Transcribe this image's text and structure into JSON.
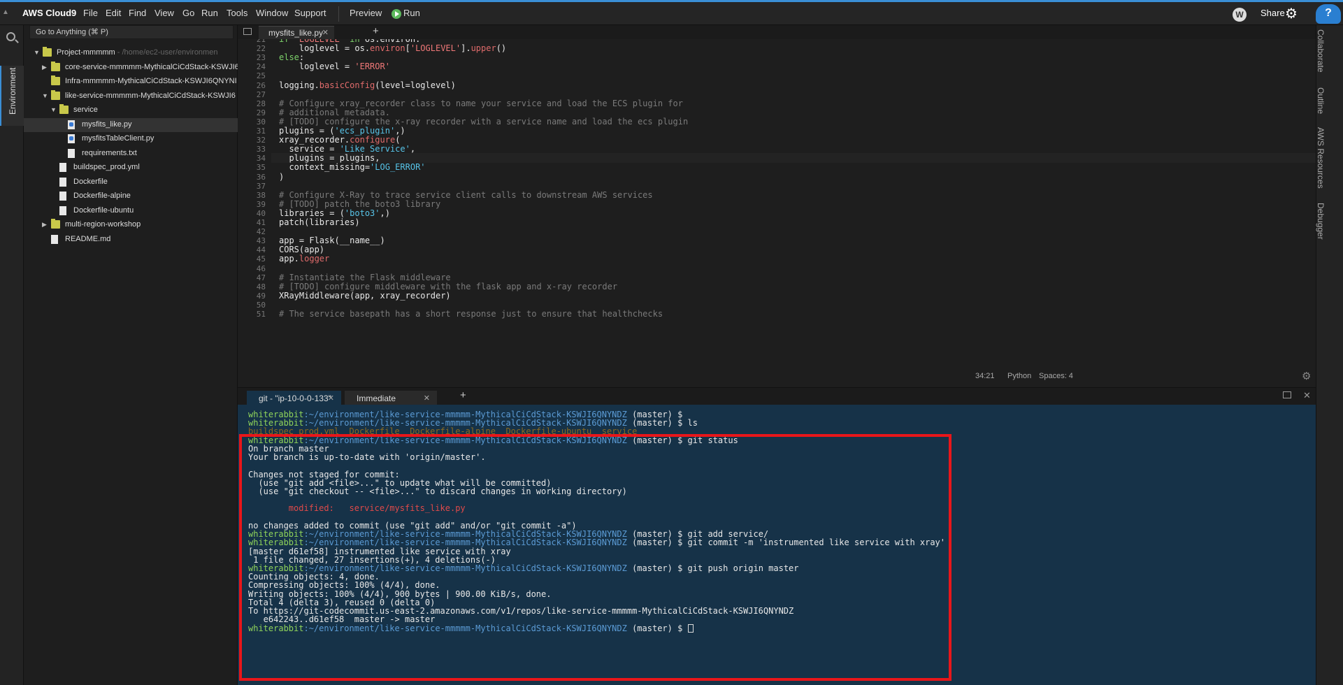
{
  "menubar": {
    "brand": "AWS Cloud9",
    "items": [
      "File",
      "Edit",
      "Find",
      "View",
      "Go",
      "Run",
      "Tools",
      "Window",
      "Support"
    ],
    "preview": "Preview",
    "run": "Run",
    "avatar": "W",
    "share": "Share"
  },
  "leftrail": {
    "environment_label": "Environment"
  },
  "search": {
    "placeholder": "Go to Anything (⌘ P)"
  },
  "tree": [
    {
      "label": "Project-mmmmm",
      "sub": " - /home/ec2-user/environmen",
      "type": "folder",
      "expanded": true
    },
    {
      "label": "core-service-mmmmm-MythicalCiCdStack-KSWJI6",
      "type": "folder",
      "expanded": false
    },
    {
      "label": "Infra-mmmmm-MythicalCiCdStack-KSWJI6QNYNI",
      "type": "folder",
      "expanded": null
    },
    {
      "label": "like-service-mmmmm-MythicalCiCdStack-KSWJI6",
      "type": "folder",
      "expanded": true
    },
    {
      "label": "service",
      "type": "folder",
      "expanded": true
    },
    {
      "label": "mysfits_like.py",
      "type": "py",
      "selected": true
    },
    {
      "label": "mysfitsTableClient.py",
      "type": "py"
    },
    {
      "label": "requirements.txt",
      "type": "file"
    },
    {
      "label": "buildspec_prod.yml",
      "type": "file"
    },
    {
      "label": "Dockerfile",
      "type": "file"
    },
    {
      "label": "Dockerfile-alpine",
      "type": "file"
    },
    {
      "label": "Dockerfile-ubuntu",
      "type": "file"
    },
    {
      "label": "multi-region-workshop",
      "type": "folder",
      "expanded": false
    },
    {
      "label": "README.md",
      "type": "file"
    }
  ],
  "editor": {
    "tab_label": "mysfits_like.py",
    "status": {
      "position": "34:21",
      "language": "Python",
      "spaces": "Spaces: 4"
    },
    "lines": [
      {
        "n": "21",
        "tokens": [
          [
            "kw",
            "if "
          ],
          [
            "str",
            "'LOGLEVEL'"
          ],
          [
            "kw",
            " in "
          ],
          [
            "",
            "os.environ:"
          ]
        ]
      },
      {
        "n": "22",
        "tokens": [
          [
            "",
            "    loglevel = os."
          ],
          [
            "fn",
            "environ"
          ],
          [
            "",
            "["
          ],
          [
            "str",
            "'LOGLEVEL'"
          ],
          [
            "",
            "]."
          ],
          [
            "fn",
            "upper"
          ],
          [
            "",
            "()"
          ]
        ]
      },
      {
        "n": "23",
        "tokens": [
          [
            "kw",
            "else"
          ],
          [
            "",
            ":"
          ]
        ]
      },
      {
        "n": "24",
        "tokens": [
          [
            "",
            "    loglevel = "
          ],
          [
            "str",
            "'ERROR'"
          ]
        ]
      },
      {
        "n": "25",
        "tokens": []
      },
      {
        "n": "26",
        "tokens": [
          [
            "",
            "logging."
          ],
          [
            "fn",
            "basicConfig"
          ],
          [
            "",
            "(level=loglevel)"
          ]
        ]
      },
      {
        "n": "27",
        "tokens": []
      },
      {
        "n": "28",
        "tokens": [
          [
            "com",
            "# Configure xray_recorder class to name your service and load the ECS plugin for"
          ]
        ]
      },
      {
        "n": "29",
        "tokens": [
          [
            "com",
            "# additional metadata."
          ]
        ]
      },
      {
        "n": "30",
        "tokens": [
          [
            "com",
            "# [TODO] configure the x-ray recorder with a service name and load the ecs plugin"
          ]
        ]
      },
      {
        "n": "31",
        "tokens": [
          [
            "",
            "plugins = ("
          ],
          [
            "str2",
            "'ecs_plugin'"
          ],
          [
            "",
            ",)"
          ]
        ]
      },
      {
        "n": "32",
        "tokens": [
          [
            "",
            "xray_recorder."
          ],
          [
            "fn",
            "configure"
          ],
          [
            "",
            "("
          ]
        ]
      },
      {
        "n": "33",
        "tokens": [
          [
            "",
            "  service = "
          ],
          [
            "str2",
            "'Like Service'"
          ],
          [
            "",
            ","
          ]
        ]
      },
      {
        "n": "34",
        "tokens": [
          [
            "",
            "  plugins = plugins,"
          ]
        ],
        "active": true
      },
      {
        "n": "35",
        "tokens": [
          [
            "",
            "  context_missing="
          ],
          [
            "str2",
            "'LOG_ERROR'"
          ]
        ]
      },
      {
        "n": "36",
        "tokens": [
          [
            "",
            ")"
          ]
        ]
      },
      {
        "n": "37",
        "tokens": []
      },
      {
        "n": "38",
        "tokens": [
          [
            "com",
            "# Configure X-Ray to trace service client calls to downstream AWS services"
          ]
        ]
      },
      {
        "n": "39",
        "tokens": [
          [
            "com",
            "# [TODO] patch the boto3 library"
          ]
        ]
      },
      {
        "n": "40",
        "tokens": [
          [
            "",
            "libraries = ("
          ],
          [
            "str2",
            "'boto3'"
          ],
          [
            "",
            ",)"
          ]
        ]
      },
      {
        "n": "41",
        "tokens": [
          [
            "",
            "patch(libraries)"
          ]
        ]
      },
      {
        "n": "42",
        "tokens": []
      },
      {
        "n": "43",
        "tokens": [
          [
            "",
            "app = Flask(__name__)"
          ]
        ]
      },
      {
        "n": "44",
        "tokens": [
          [
            "",
            "CORS(app)"
          ]
        ]
      },
      {
        "n": "45",
        "tokens": [
          [
            "",
            "app."
          ],
          [
            "fn",
            "logger"
          ]
        ]
      },
      {
        "n": "46",
        "tokens": []
      },
      {
        "n": "47",
        "tokens": [
          [
            "com",
            "# Instantiate the Flask middleware"
          ]
        ]
      },
      {
        "n": "48",
        "tokens": [
          [
            "com",
            "# [TODO] configure middleware with the flask app and x-ray recorder"
          ]
        ]
      },
      {
        "n": "49",
        "tokens": [
          [
            "",
            "XRayMiddleware(app, xray_recorder)"
          ]
        ]
      },
      {
        "n": "50",
        "tokens": []
      },
      {
        "n": "51",
        "tokens": [
          [
            "com",
            "# The service basepath has a short response just to ensure that healthchecks"
          ]
        ]
      }
    ]
  },
  "right_tabs": [
    "Collaborate",
    "Outline",
    "AWS Resources",
    "Debugger"
  ],
  "terminal": {
    "tabs": [
      "git - \"ip-10-0-0-133\"",
      "Immediate"
    ],
    "prompt_user": "whiterabbit",
    "prompt_path": ":~/environment/like-service-mmmmm-MythicalCiCdStack-KSWJI6QNYNDZ",
    "prompt_branch": " (master) $ ",
    "lines": [
      {
        "kind": "prompt",
        "cmd": ""
      },
      {
        "kind": "prompt",
        "cmd": "ls"
      },
      {
        "kind": "ghost",
        "text": "buildspec_prod.yml  Dockerfile  Dockerfile-alpine  Dockerfile-ubuntu  service"
      },
      {
        "kind": "prompt",
        "cmd": "git status"
      },
      {
        "kind": "out",
        "text": "On branch master"
      },
      {
        "kind": "out",
        "text": "Your branch is up-to-date with 'origin/master'."
      },
      {
        "kind": "out",
        "text": ""
      },
      {
        "kind": "out",
        "text": "Changes not staged for commit:"
      },
      {
        "kind": "out",
        "text": "  (use \"git add <file>...\" to update what will be committed)"
      },
      {
        "kind": "out",
        "text": "  (use \"git checkout -- <file>...\" to discard changes in working directory)"
      },
      {
        "kind": "out",
        "text": ""
      },
      {
        "kind": "mod",
        "text": "        modified:   service/mysfits_like.py"
      },
      {
        "kind": "out",
        "text": ""
      },
      {
        "kind": "out",
        "text": "no changes added to commit (use \"git add\" and/or \"git commit -a\")"
      },
      {
        "kind": "prompt",
        "cmd": "git add service/"
      },
      {
        "kind": "prompt",
        "cmd": "git commit -m 'instrumented like service with xray'"
      },
      {
        "kind": "out",
        "text": "[master d61ef58] instrumented like service with xray"
      },
      {
        "kind": "out",
        "text": " 1 file changed, 27 insertions(+), 4 deletions(-)"
      },
      {
        "kind": "prompt",
        "cmd": "git push origin master"
      },
      {
        "kind": "out",
        "text": "Counting objects: 4, done."
      },
      {
        "kind": "out",
        "text": "Compressing objects: 100% (4/4), done."
      },
      {
        "kind": "out",
        "text": "Writing objects: 100% (4/4), 900 bytes | 900.00 KiB/s, done."
      },
      {
        "kind": "out",
        "text": "Total 4 (delta 3), reused 0 (delta 0)"
      },
      {
        "kind": "out",
        "text": "To https://git-codecommit.us-east-2.amazonaws.com/v1/repos/like-service-mmmmm-MythicalCiCdStack-KSWJI6QNYNDZ"
      },
      {
        "kind": "out",
        "text": "   e642243..d61ef58  master -> master"
      },
      {
        "kind": "prompt",
        "cmd": "",
        "cursor": true
      }
    ]
  },
  "colors": {
    "highlight": "#e8161a",
    "accent": "#3a8fd6",
    "terminal_bg": "#163248"
  }
}
